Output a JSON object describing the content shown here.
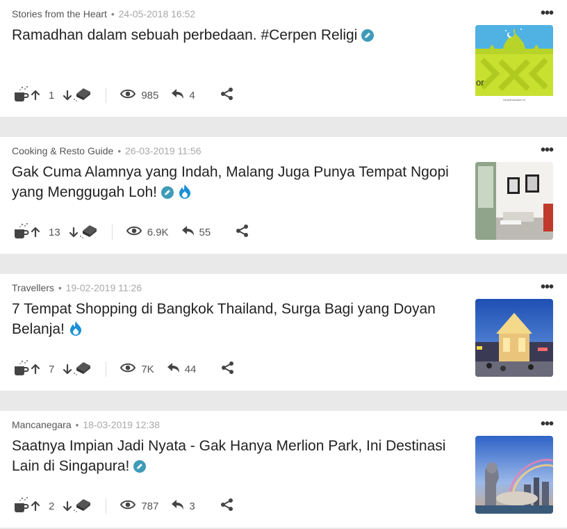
{
  "posts": [
    {
      "category": "Stories from the Heart",
      "date": "24-05-2018 16:52",
      "title": "Ramadhan dalam sebuah perbedaan. #Cerpen Religi",
      "badges": [
        "pencil-badge-icon"
      ],
      "upvotes": "1",
      "views": "985",
      "replies": "4",
      "thumb_text": "or",
      "thumb_caption": "ramadhankaleri.id"
    },
    {
      "category": "Cooking & Resto Guide",
      "date": "26-03-2019 11:56",
      "title": "Gak Cuma Alamnya yang Indah, Malang Juga Punya Tempat Ngopi yang Menggugah Loh!",
      "badges": [
        "pencil-badge-icon",
        "hot-flame-icon"
      ],
      "upvotes": "13",
      "views": "6.9K",
      "replies": "55"
    },
    {
      "category": "Travellers",
      "date": "19-02-2019 11:26",
      "title": "7 Tempat Shopping di Bangkok Thailand, Surga Bagi yang Doyan Belanja!",
      "badges": [
        "hot-flame-icon"
      ],
      "upvotes": "7",
      "views": "7K",
      "replies": "44"
    },
    {
      "category": "Mancanegara",
      "date": "18-03-2019 12:38",
      "title": "Saatnya Impian Jadi Nyata - Gak Hanya Merlion Park, Ini Destinasi Lain di Singapura!",
      "badges": [
        "pencil-badge-icon"
      ],
      "upvotes": "2",
      "views": "787",
      "replies": "3"
    }
  ],
  "ui": {
    "more_label": "•••",
    "meta_separator": "•"
  },
  "colors": {
    "accent_badge": "#3e9bb8",
    "flame": "#1a8fd6"
  }
}
